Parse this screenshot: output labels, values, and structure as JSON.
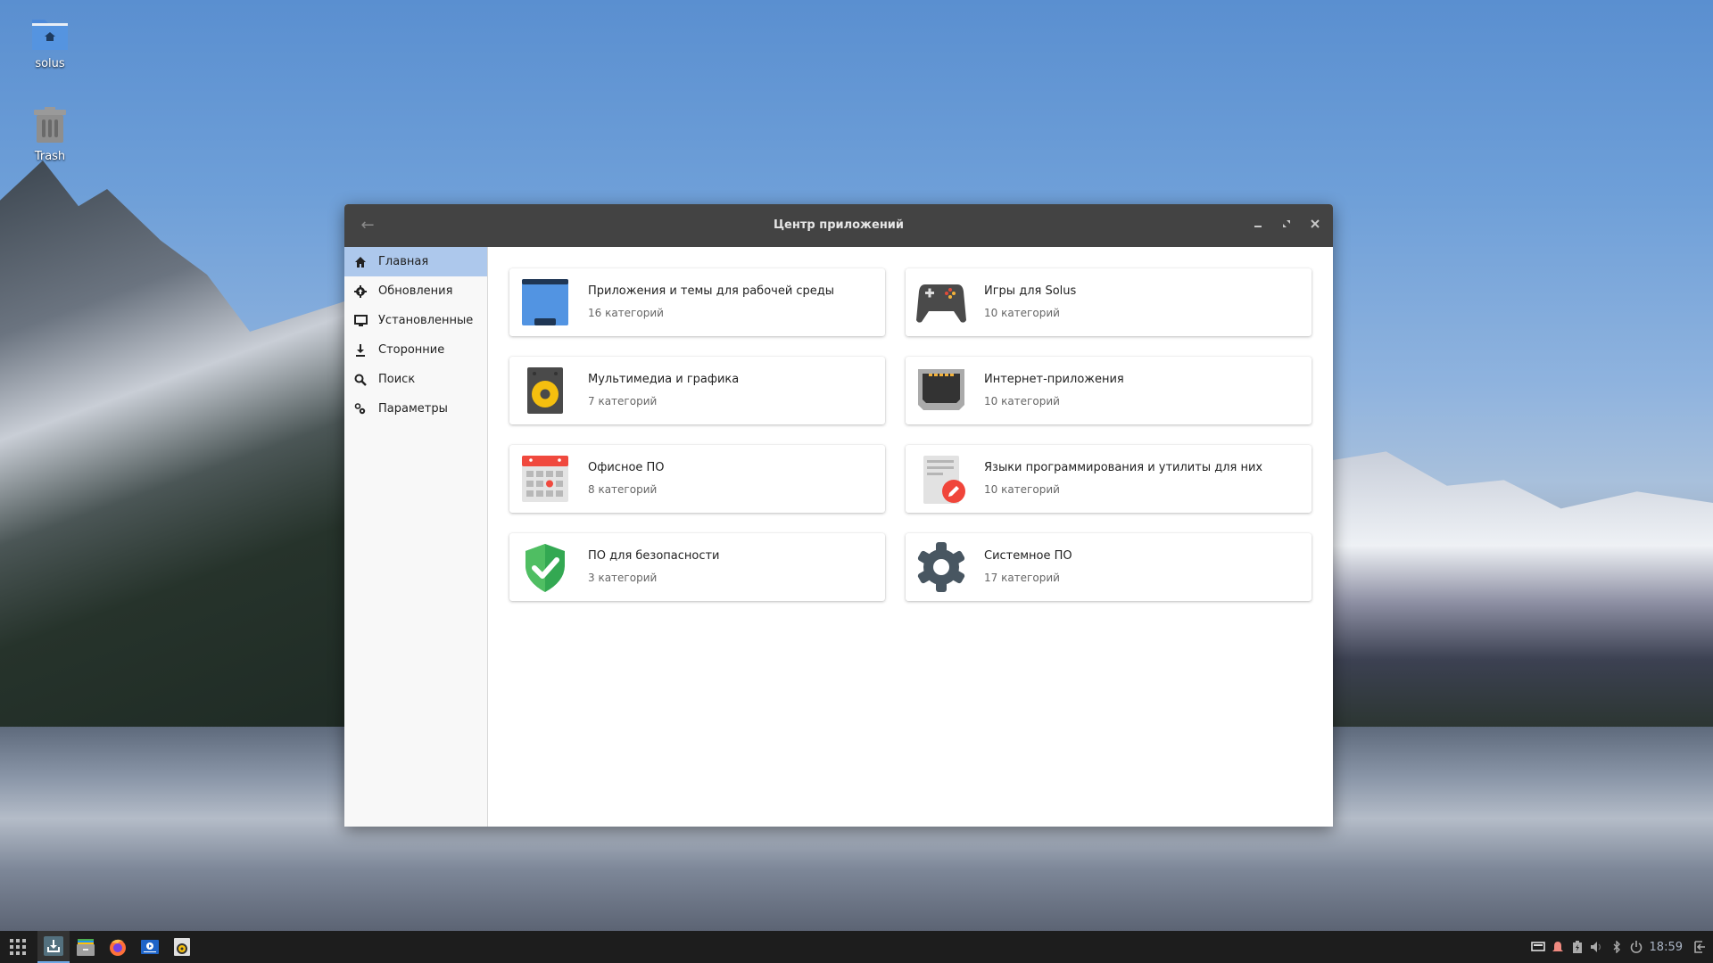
{
  "desktop": {
    "icons": [
      {
        "label": "solus",
        "icon": "home-folder-icon"
      },
      {
        "label": "Trash",
        "icon": "trash-icon"
      }
    ]
  },
  "window": {
    "title": "Центр приложений",
    "buttons": {
      "back": "←",
      "minimize": "–",
      "maximize": "⤢",
      "close": "✕"
    }
  },
  "sidebar": {
    "items": [
      {
        "label": "Главная",
        "icon": "home-icon",
        "active": true
      },
      {
        "label": "Обновления",
        "icon": "updates-icon",
        "active": false
      },
      {
        "label": "Установленные",
        "icon": "monitor-icon",
        "active": false
      },
      {
        "label": "Сторонние",
        "icon": "download-icon",
        "active": false
      },
      {
        "label": "Поиск",
        "icon": "search-icon",
        "active": false
      },
      {
        "label": "Параметры",
        "icon": "settings-icon",
        "active": false
      }
    ]
  },
  "categories": [
    {
      "title": "Приложения и темы для рабочей среды",
      "subtitle": "16 категорий",
      "icon": "desktop-icon"
    },
    {
      "title": "Игры для Solus",
      "subtitle": "10 категорий",
      "icon": "gamepad-icon"
    },
    {
      "title": "Мультимедиа и графика",
      "subtitle": "7 категорий",
      "icon": "speaker-icon"
    },
    {
      "title": "Интернет-приложения",
      "subtitle": "10 категорий",
      "icon": "ethernet-icon"
    },
    {
      "title": "Офисное ПО",
      "subtitle": "8 категорий",
      "icon": "calendar-icon"
    },
    {
      "title": "Языки программирования и утилиты для них",
      "subtitle": "10 категорий",
      "icon": "text-editor-icon"
    },
    {
      "title": "ПО для безопасности",
      "subtitle": "3 категорий",
      "icon": "shield-check-icon"
    },
    {
      "title": "Системное ПО",
      "subtitle": "17 категорий",
      "icon": "gear-icon"
    }
  ],
  "taskbar": {
    "apps": [
      {
        "name": "app-launcher",
        "icon": "grid-icon"
      },
      {
        "name": "software-center",
        "icon": "software-center-icon",
        "active": true
      },
      {
        "name": "files",
        "icon": "file-manager-icon"
      },
      {
        "name": "firefox",
        "icon": "firefox-icon"
      },
      {
        "name": "video-player",
        "icon": "video-player-icon"
      },
      {
        "name": "rhythmbox",
        "icon": "speaker-icon"
      }
    ],
    "tray": {
      "clock": "18:59",
      "icons": [
        "network-icon",
        "notification-icon",
        "battery-icon",
        "volume-icon",
        "bluetooth-icon",
        "power-icon",
        "logout-icon"
      ]
    }
  },
  "colors": {
    "titlebar": "#434343",
    "sidebar_active": "#adc8ec",
    "accent": "#6fa8e6"
  }
}
